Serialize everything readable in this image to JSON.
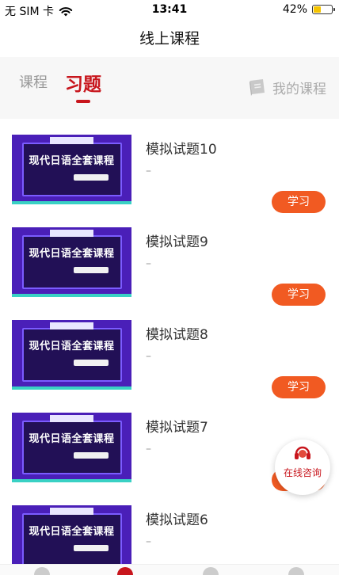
{
  "status_bar": {
    "carrier": "无 SIM 卡",
    "time": "13:41",
    "battery_percent": "42%",
    "battery_level": 0.42,
    "wifi_icon": "wifi-icon"
  },
  "header": {
    "title": "线上课程"
  },
  "tabs": {
    "items": [
      {
        "label": "课程",
        "active": false
      },
      {
        "label": "习题",
        "active": true
      }
    ],
    "my_courses_label": "我的课程",
    "accent_color": "#c8161d"
  },
  "list": {
    "thumbnail_text": "现代日语全套课程",
    "button_color": "#f15a22",
    "items": [
      {
        "title": "模拟试题10",
        "subtitle": "–",
        "button": "学习"
      },
      {
        "title": "模拟试题9",
        "subtitle": "–",
        "button": "学习"
      },
      {
        "title": "模拟试题8",
        "subtitle": "–",
        "button": "学习"
      },
      {
        "title": "模拟试题7",
        "subtitle": "–",
        "button": "学习"
      },
      {
        "title": "模拟试题6",
        "subtitle": "–",
        "button": ""
      }
    ]
  },
  "consult": {
    "label": "在线咨询",
    "icon": "headset-icon"
  }
}
